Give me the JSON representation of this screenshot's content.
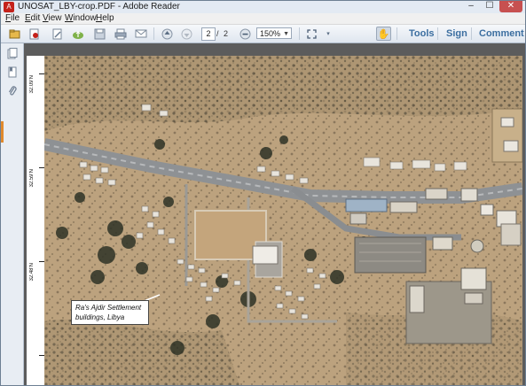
{
  "window": {
    "title": "UNOSAT_LBY-crop.PDF - Adobe Reader",
    "controls": {
      "minimize": "–",
      "maximize": "☐",
      "close": "✕"
    }
  },
  "menu": [
    "File",
    "Edit",
    "View",
    "Window",
    "Help"
  ],
  "toolbar": {
    "page_current": "2",
    "page_separator": "/",
    "page_total": "2",
    "zoom": "150%",
    "tools_label": "Tools",
    "sign_label": "Sign",
    "comment_label": "Comment",
    "accent_color": "#3b6ea0"
  },
  "document": {
    "latitudes": [
      "32.09'N",
      "32.59'N",
      "32.48'N"
    ],
    "callout_line1": "Ra's Ajdir Settlement",
    "callout_line2": "buildings, Libya"
  }
}
